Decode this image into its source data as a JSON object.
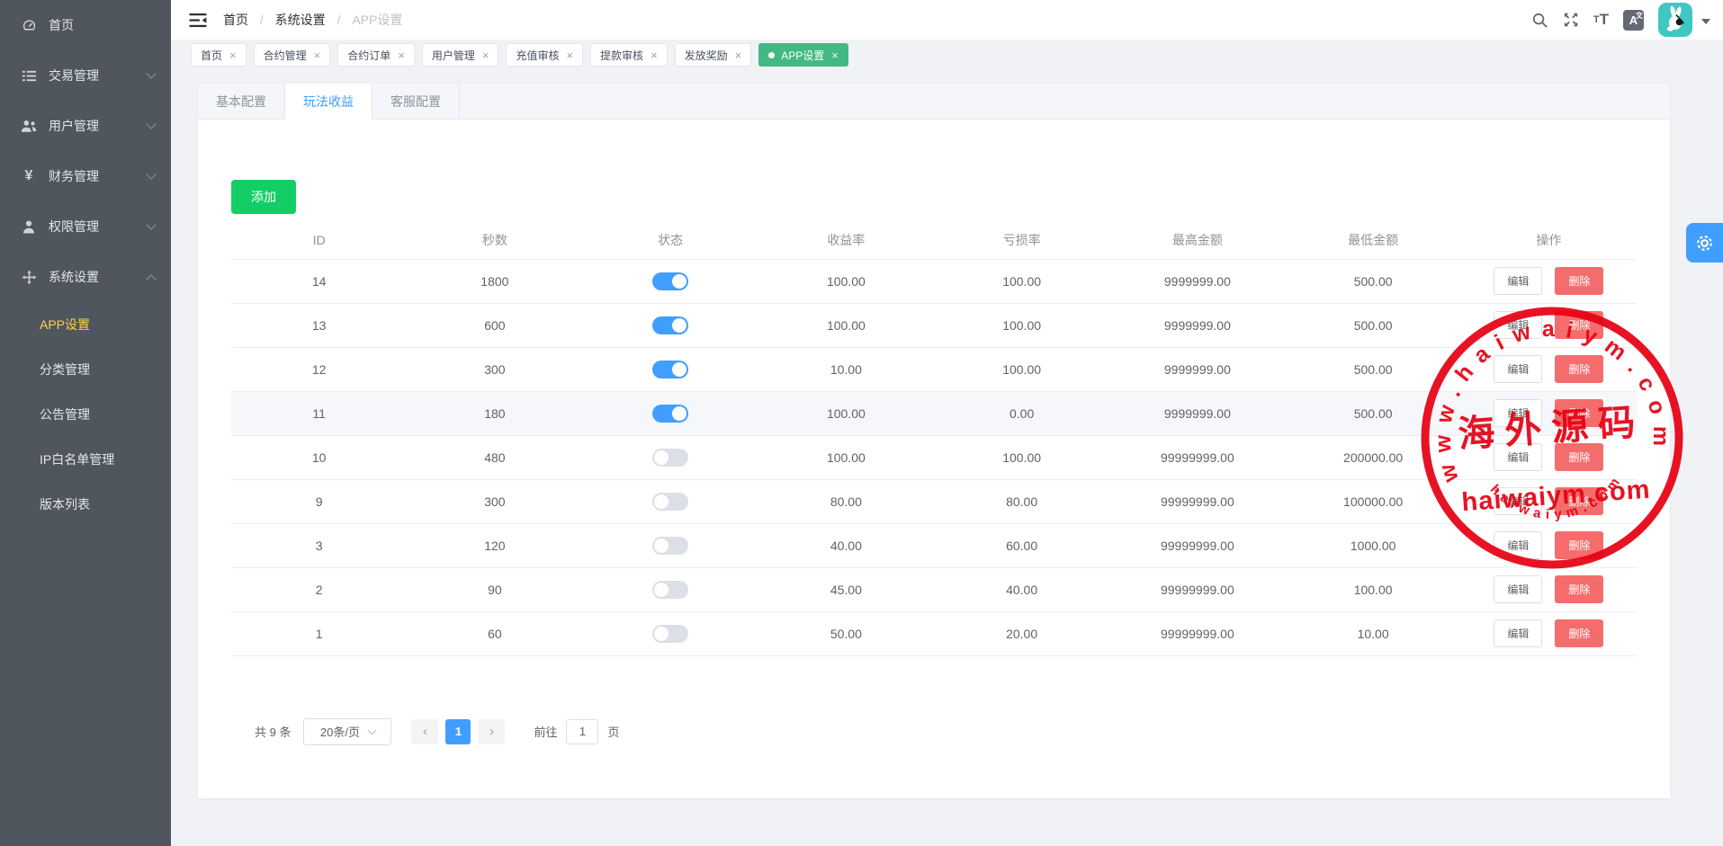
{
  "sidebar": {
    "items": [
      {
        "key": "home",
        "label": "首页",
        "icon": "dashboard-icon"
      },
      {
        "key": "trade-manage",
        "label": "交易管理",
        "icon": "trade-icon",
        "chevron": "down"
      },
      {
        "key": "user-manage",
        "label": "用户管理",
        "icon": "users-icon",
        "chevron": "down"
      },
      {
        "key": "finance-manage",
        "label": "财务管理",
        "icon": "finance-icon",
        "chevron": "down"
      },
      {
        "key": "permission-manage",
        "label": "权限管理",
        "icon": "permission-icon",
        "chevron": "down"
      },
      {
        "key": "system-settings",
        "label": "系统设置",
        "icon": "settings-icon",
        "chevron": "up",
        "expanded": true
      }
    ],
    "sub_items": [
      {
        "key": "app-settings",
        "label": "APP设置",
        "active": true
      },
      {
        "key": "category-manage",
        "label": "分类管理"
      },
      {
        "key": "notice-manage",
        "label": "公告管理"
      },
      {
        "key": "ip-whitelist",
        "label": "IP白名单管理"
      },
      {
        "key": "version-list",
        "label": "版本列表"
      }
    ]
  },
  "header": {
    "breadcrumb": [
      "首页",
      "系统设置",
      "APP设置"
    ],
    "breadcrumb_separator": "/"
  },
  "tags": [
    {
      "key": "home",
      "label": "首页"
    },
    {
      "key": "contract-manage",
      "label": "合约管理"
    },
    {
      "key": "contract-orders",
      "label": "合约订单"
    },
    {
      "key": "user-manage",
      "label": "用户管理"
    },
    {
      "key": "recharge-audit",
      "label": "充值审核"
    },
    {
      "key": "withdraw-audit",
      "label": "提款审核"
    },
    {
      "key": "reward-grant",
      "label": "发放奖励"
    },
    {
      "key": "app-settings",
      "label": "APP设置",
      "active": true
    }
  ],
  "tabs": [
    {
      "key": "basic-config",
      "label": "基本配置"
    },
    {
      "key": "play-profit",
      "label": "玩法收益",
      "active": true
    },
    {
      "key": "service-config",
      "label": "客服配置"
    }
  ],
  "toolbar": {
    "add_label": "添加"
  },
  "table": {
    "columns": [
      "ID",
      "秒数",
      "状态",
      "收益率",
      "亏损率",
      "最高金额",
      "最低金额",
      "操作"
    ],
    "edit_label": "编辑",
    "delete_label": "删除",
    "rows": [
      {
        "id": "14",
        "seconds": "1800",
        "status": true,
        "profit_rate": "100.00",
        "loss_rate": "100.00",
        "max_amount": "9999999.00",
        "min_amount": "500.00"
      },
      {
        "id": "13",
        "seconds": "600",
        "status": true,
        "profit_rate": "100.00",
        "loss_rate": "100.00",
        "max_amount": "9999999.00",
        "min_amount": "500.00"
      },
      {
        "id": "12",
        "seconds": "300",
        "status": true,
        "profit_rate": "10.00",
        "loss_rate": "100.00",
        "max_amount": "9999999.00",
        "min_amount": "500.00"
      },
      {
        "id": "11",
        "seconds": "180",
        "status": true,
        "profit_rate": "100.00",
        "loss_rate": "0.00",
        "max_amount": "9999999.00",
        "min_amount": "500.00",
        "highlighted": true
      },
      {
        "id": "10",
        "seconds": "480",
        "status": false,
        "profit_rate": "100.00",
        "loss_rate": "100.00",
        "max_amount": "99999999.00",
        "min_amount": "200000.00"
      },
      {
        "id": "9",
        "seconds": "300",
        "status": false,
        "profit_rate": "80.00",
        "loss_rate": "80.00",
        "max_amount": "99999999.00",
        "min_amount": "100000.00"
      },
      {
        "id": "3",
        "seconds": "120",
        "status": false,
        "profit_rate": "40.00",
        "loss_rate": "60.00",
        "max_amount": "99999999.00",
        "min_amount": "1000.00"
      },
      {
        "id": "2",
        "seconds": "90",
        "status": false,
        "profit_rate": "45.00",
        "loss_rate": "40.00",
        "max_amount": "99999999.00",
        "min_amount": "100.00"
      },
      {
        "id": "1",
        "seconds": "60",
        "status": false,
        "profit_rate": "50.00",
        "loss_rate": "20.00",
        "max_amount": "99999999.00",
        "min_amount": "10.00"
      }
    ]
  },
  "pagination": {
    "total_text": "共 9 条",
    "page_size": "20条/页",
    "prev_icon": "‹",
    "next_icon": "›",
    "current_page": "1",
    "goto_label": "前往",
    "goto_value": "1",
    "page_unit": "页"
  },
  "watermark": {
    "top_text": "www.haiwaiym.com",
    "center_text": "海外源码",
    "domain_text": "haiwaiym.com",
    "bottom_text": "haiwaiym.com"
  },
  "colors": {
    "accent": "#409eff",
    "tag_green": "#42b983",
    "add_green": "#13ce66",
    "danger": "#f56c6c",
    "sidebar_bg": "#50565e",
    "menu_active_text": "#ffd04b",
    "watermark_red": "#e60012",
    "avatar_teal": "#3fc7c3"
  }
}
